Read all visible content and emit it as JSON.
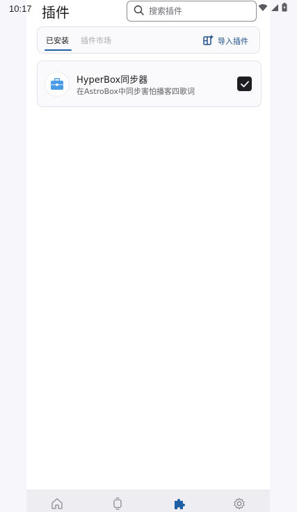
{
  "status_bar": {
    "time": "10:17",
    "icons": [
      "wifi-icon",
      "cellular-signal-icon",
      "battery-icon"
    ]
  },
  "header": {
    "title": "插件",
    "search_placeholder": "搜索插件"
  },
  "tabs": {
    "items": [
      {
        "label": "已安装",
        "active": true
      },
      {
        "label": "插件市场",
        "active": false
      }
    ],
    "import_button_label": "导入插件"
  },
  "plugins": [
    {
      "name": "HyperBox同步器",
      "description": "在AstroBox中同步害怕播客四歌词",
      "enabled": true,
      "icon": "toolbox-icon"
    }
  ],
  "bottom_nav": {
    "items": [
      {
        "icon": "home-icon",
        "active": false
      },
      {
        "icon": "watch-icon",
        "active": false
      },
      {
        "icon": "puzzle-icon",
        "active": true
      },
      {
        "icon": "settings-gear-icon",
        "active": false
      }
    ]
  },
  "colors": {
    "accent": "#1f5fa6",
    "background": "#f7f6fb",
    "active_nav": "#1f5fa6"
  }
}
